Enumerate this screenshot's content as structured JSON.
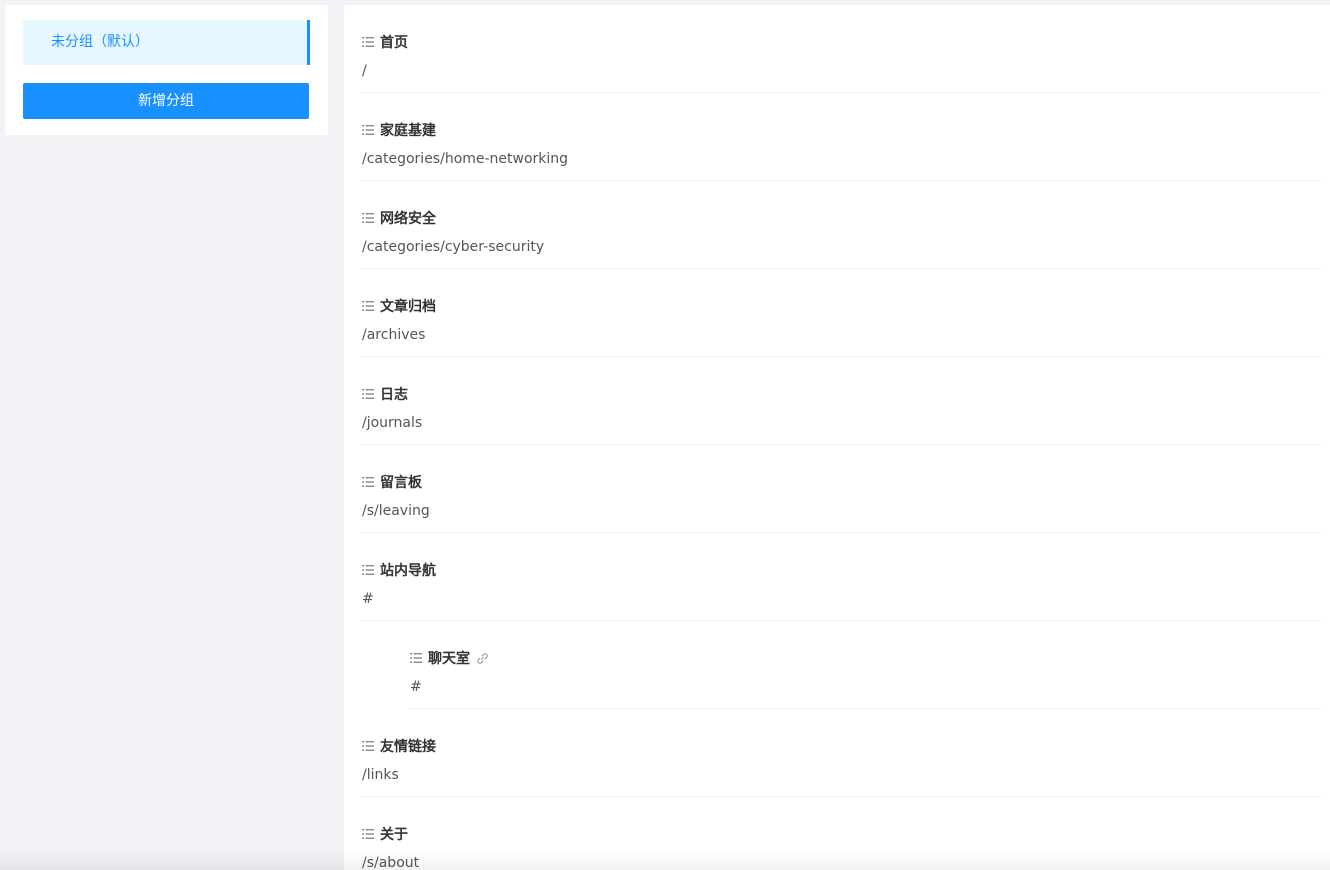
{
  "groups": {
    "items": [
      {
        "label": "未分组（默认）"
      }
    ],
    "add_label": "新增分组"
  },
  "menus": [
    {
      "name": "首页",
      "path": "/"
    },
    {
      "name": "家庭基建",
      "path": "/categories/home-networking"
    },
    {
      "name": "网络安全",
      "path": "/categories/cyber-security"
    },
    {
      "name": "文章归档",
      "path": "/archives"
    },
    {
      "name": "日志",
      "path": "/journals"
    },
    {
      "name": "留言板",
      "path": "/s/leaving"
    },
    {
      "name": "站内导航",
      "path": "#"
    },
    {
      "name": "聊天室",
      "path": "#",
      "child": true,
      "external_link_icon": "link-icon"
    },
    {
      "name": "友情链接",
      "path": "/links"
    },
    {
      "name": "关于",
      "path": "/s/about"
    }
  ],
  "icons": {
    "drag": "drag-handle-icon",
    "link": "link-icon"
  },
  "colors": {
    "accent": "#1890ff",
    "selected_bg": "#e6f7ff",
    "background": "#f0f2f5"
  }
}
